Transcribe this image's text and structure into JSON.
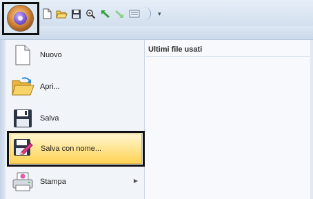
{
  "menu": {
    "items": [
      {
        "label": "Nuovo",
        "icon": "new-document-icon"
      },
      {
        "label": "Apri...",
        "icon": "open-folder-icon"
      },
      {
        "label": "Salva",
        "icon": "floppy-disk-icon"
      },
      {
        "label": "Salva con nome...",
        "icon": "save-as-icon"
      },
      {
        "label": "Stampa",
        "icon": "printer-icon"
      }
    ]
  },
  "recent": {
    "title": "Ultimi file usati"
  },
  "quick_access": {
    "items": [
      "new-document-icon",
      "open-folder-icon",
      "floppy-disk-icon",
      "zoom-icon",
      "undo-icon",
      "redo-icon",
      "display-icon"
    ],
    "dropdown_glyph": "▾"
  },
  "colors": {
    "selection_highlight": "#ffd256",
    "accent": "#3f6eb2"
  }
}
